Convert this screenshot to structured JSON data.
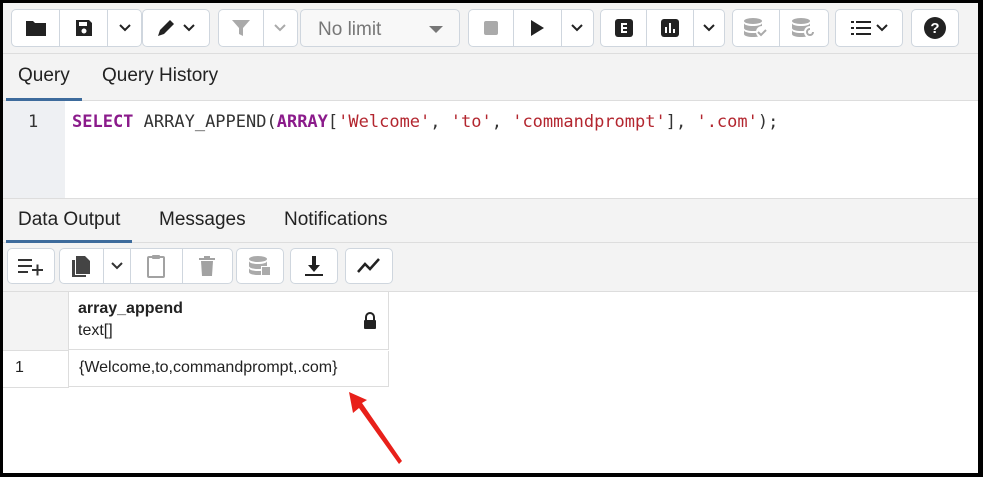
{
  "toolbar": {
    "row_limit": "No limit",
    "buttons": [
      "open-file",
      "save-file",
      "edit",
      "filter",
      "stop",
      "execute",
      "explain",
      "explain-analyze",
      "commit",
      "rollback",
      "macros",
      "help"
    ]
  },
  "query_tabs": {
    "query": "Query",
    "history": "Query History"
  },
  "editor": {
    "line_number": "1",
    "tokens": {
      "select": "SELECT",
      "func_open": " ARRAY_APPEND(",
      "array_kw": "ARRAY",
      "bracket_open": "[",
      "s1": "'Welcome'",
      "comma1": ", ",
      "s2": "'to'",
      "comma2": ", ",
      "s3": "'commandprompt'",
      "bracket_close": "], ",
      "s4": "'.com'",
      "end": ");"
    }
  },
  "output_tabs": {
    "data_output": "Data Output",
    "messages": "Messages",
    "notifications": "Notifications"
  },
  "grid": {
    "column": {
      "name": "array_append",
      "type": "text[]"
    },
    "rows": [
      {
        "num": "1",
        "value": "{Welcome,to,commandprompt,.com}"
      }
    ]
  },
  "colors": {
    "accent": "#3d6b9c",
    "keyword": "#8b1b8b",
    "string": "#b3262f",
    "arrow": "#e8201a"
  }
}
